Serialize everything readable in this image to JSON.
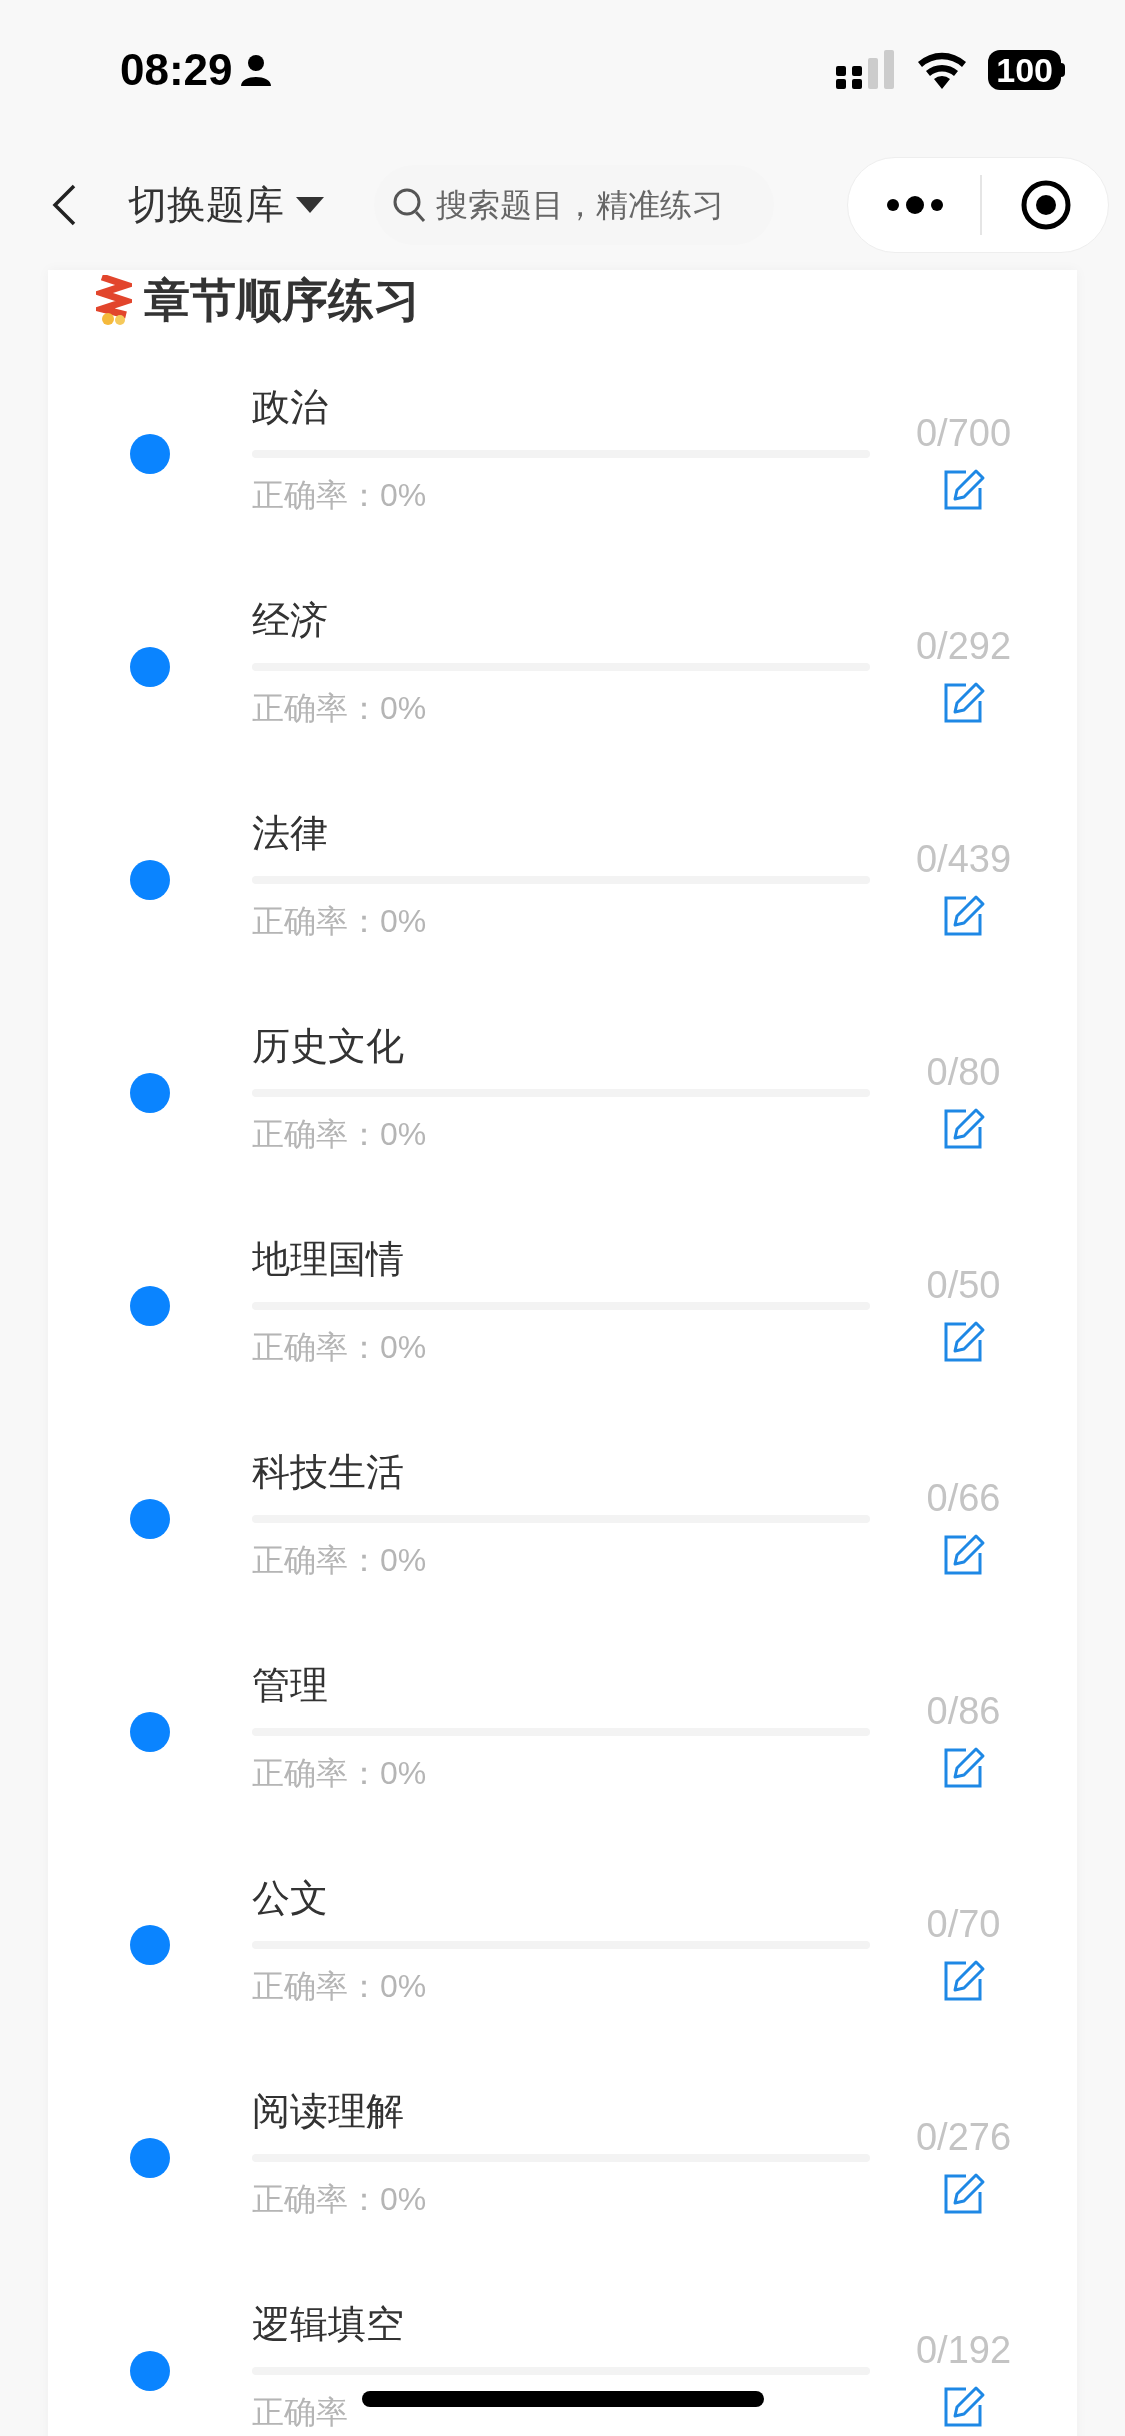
{
  "status_bar": {
    "time": "08:29",
    "battery": "100"
  },
  "nav": {
    "title": "切换题库",
    "search": {
      "placeholder": "搜索题目，精准练习"
    }
  },
  "section": {
    "title": "章节顺序练习"
  },
  "chapters": [
    {
      "name": "政治",
      "accuracy": "正确率：0%",
      "count": "0/700",
      "level": 0
    },
    {
      "name": "经济",
      "accuracy": "正确率：0%",
      "count": "0/292",
      "level": 0
    },
    {
      "name": "法律",
      "accuracy": "正确率：0%",
      "count": "0/439",
      "level": 0
    },
    {
      "name": "历史文化",
      "accuracy": "正确率：0%",
      "count": "0/80",
      "level": 0
    },
    {
      "name": "地理国情",
      "accuracy": "正确率：0%",
      "count": "0/50",
      "level": 0
    },
    {
      "name": "科技生活",
      "accuracy": "正确率：0%",
      "count": "0/66",
      "level": 0
    },
    {
      "name": "管理",
      "accuracy": "正确率：0%",
      "count": "0/86",
      "level": 0
    },
    {
      "name": "公文",
      "accuracy": "正确率：0%",
      "count": "0/70",
      "level": 0
    },
    {
      "name": "阅读理解",
      "accuracy": "正确率：0%",
      "count": "0/276",
      "level": 0
    },
    {
      "name": "逻辑填空",
      "accuracy": "正确率",
      "count": "0/192",
      "level": 0
    }
  ]
}
